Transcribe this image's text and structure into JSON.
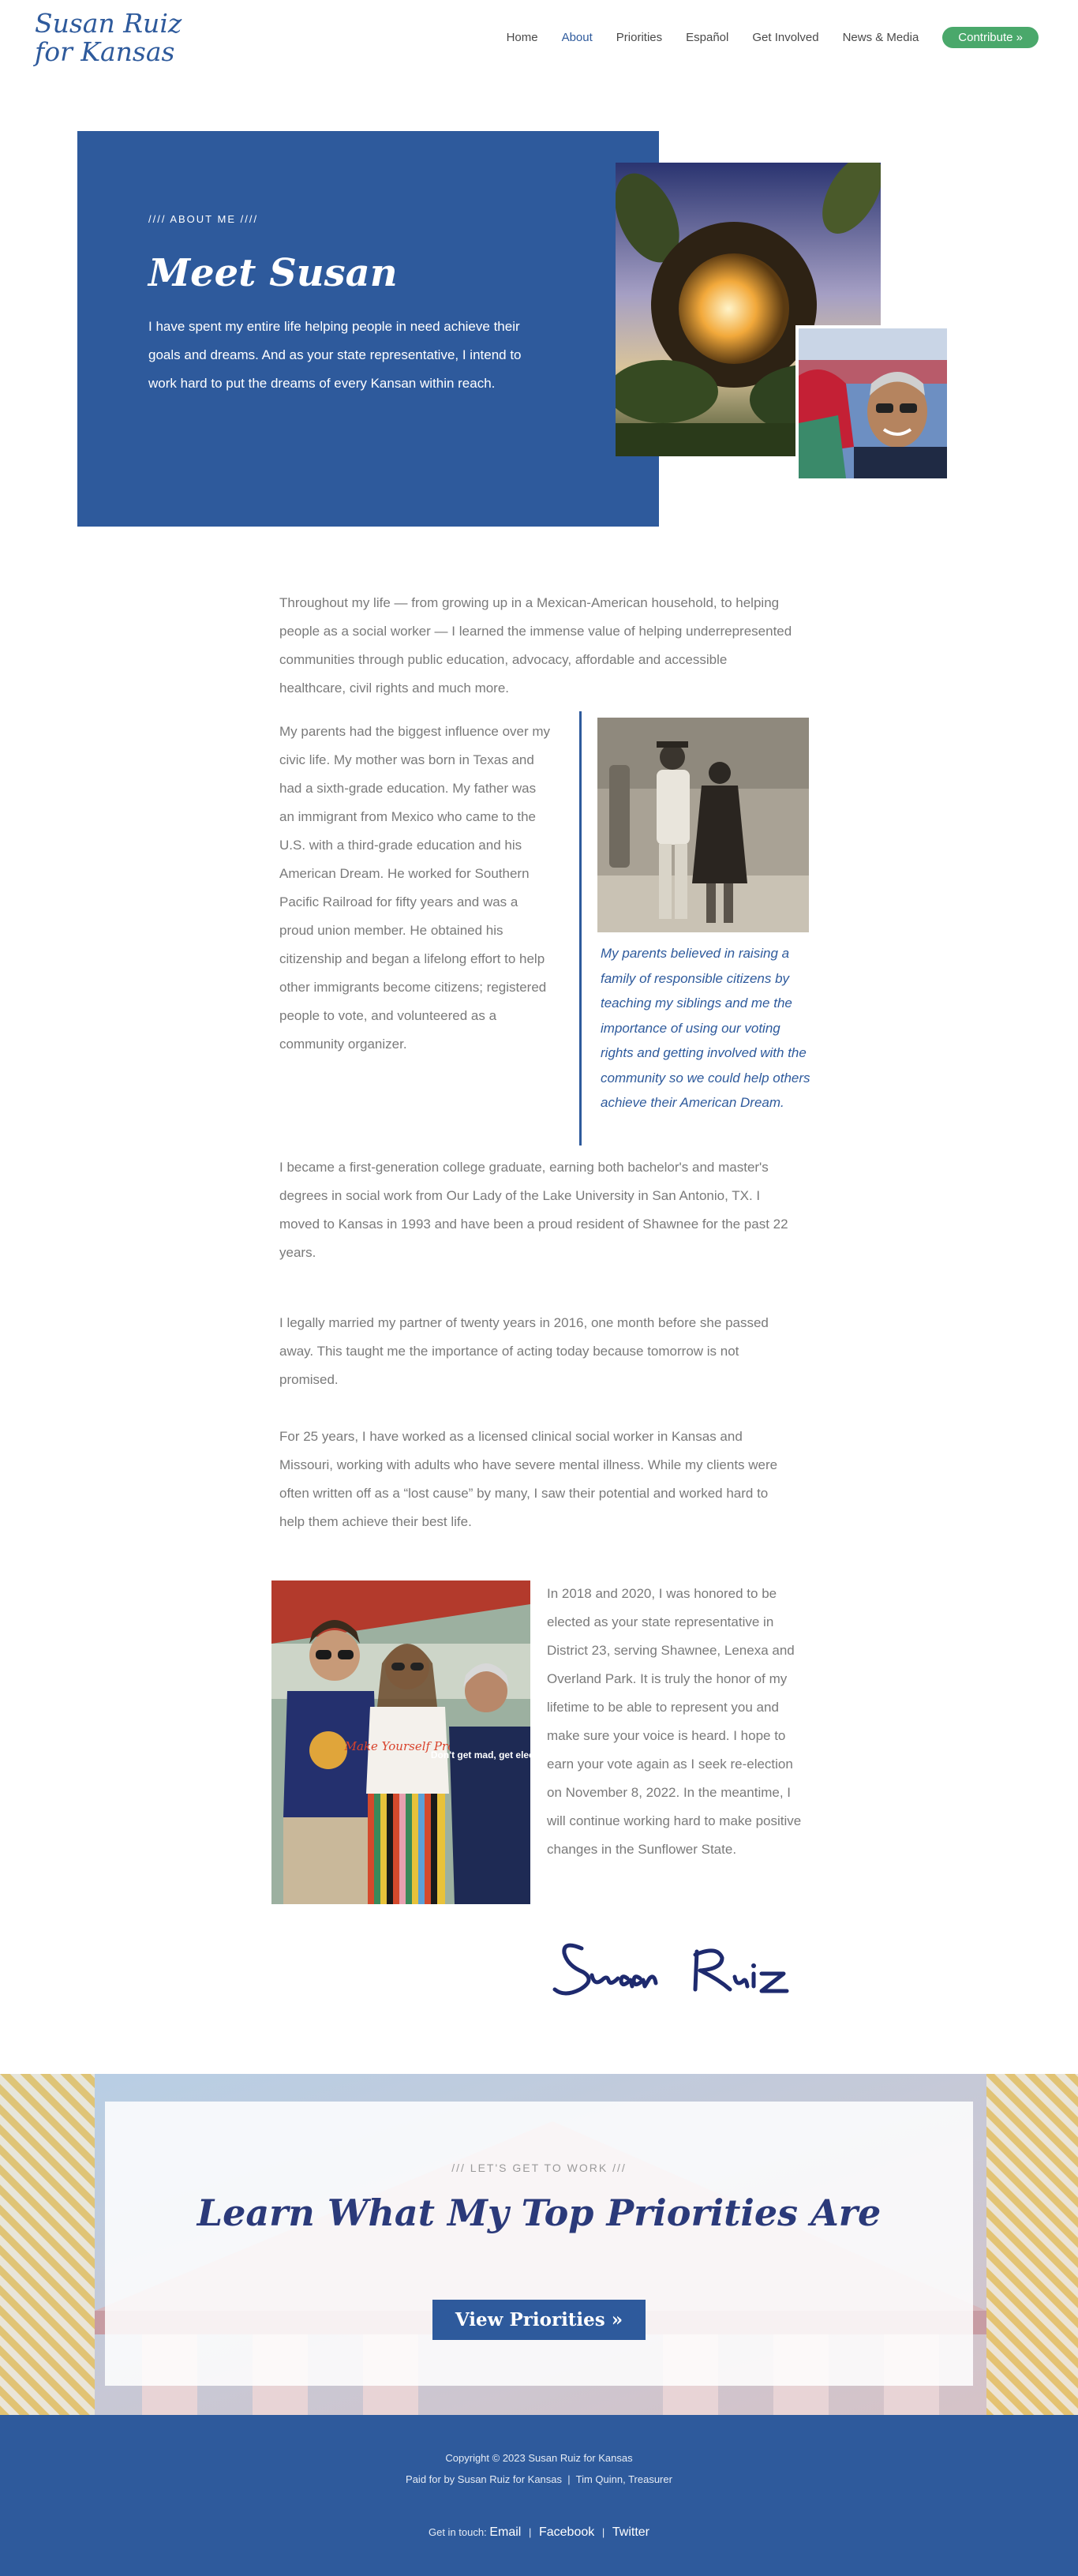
{
  "header": {
    "logo_line1": "Susan Ruiz",
    "logo_line2": "for Kansas",
    "nav": [
      {
        "label": "Home"
      },
      {
        "label": "About"
      },
      {
        "label": "Priorities"
      },
      {
        "label": "Español"
      },
      {
        "label": "Get Involved"
      },
      {
        "label": "News & Media"
      }
    ],
    "contribute_label": "Contribute  »"
  },
  "hero": {
    "eyebrow": "//// ABOUT ME ////",
    "title": "Meet Susan",
    "text": "I have spent my entire life helping people in need achieve their goals and dreams. And as your state representative, I intend to work hard to put the dreams of every Kansan within reach."
  },
  "body": {
    "p1": "Throughout my life — from growing up in a Mexican-American household, to helping people as a social worker — I learned the immense value of helping underrepresented communities through public education, advocacy, affordable and accessible healthcare, civil rights and much more.",
    "p2": "My parents had the biggest influence over my civic life. My mother was born in Texas and had a sixth-grade education. My father was an immigrant from Mexico who came to the U.S. with a third-grade education and his American Dream. He worked for Southern Pacific Railroad for fifty years and was a proud union member. He obtained his citizenship and began a lifelong effort to help other immigrants become citizens; registered people to vote, and volunteered as a community organizer.",
    "quote": "My parents believed in raising a family of responsible citizens by teaching my siblings and me the importance of using our voting rights and getting involved with the community so we could help others achieve their American Dream.",
    "p3": "I became a first-generation college graduate, earning both bachelor's and master's degrees in social work from Our Lady of the Lake University in San Antonio, TX. I moved to Kansas in 1993 and have been a proud resident of Shawnee for the past 22 years.",
    "p4": "I legally married my partner of twenty years in 2016, one month before she passed away. This taught me the importance of acting today because tomorrow is not promised.",
    "p5": "For 25 years, I have worked as a licensed clinical social worker in Kansas and Missouri, working with adults who have severe mental illness. While my clients were often written off as a “lost cause” by many, I saw their potential and worked hard to help them achieve their best life.",
    "p6": "In 2018 and 2020, I was honored to be elected as your state representative in District 23, serving Shawnee, Lenexa and Overland Park. It is truly the honor of my lifetime to be able to represent you and make sure your voice is heard. I hope to earn your vote again as I seek re-election on November 8, 2022. In the meantime, I will continue working hard to make positive changes in the Sunflower State.",
    "tshirt_center": "Make Yourself Proud",
    "tshirt_right": "Don't get mad, get elected."
  },
  "cta": {
    "eyebrow": "/// LET'S GET TO WORK ///",
    "title": "Learn What My Top Priorities Are",
    "button": "View Priorities »"
  },
  "footer": {
    "copyright": "Copyright © 2023 Susan Ruiz for Kansas",
    "paid_for": "Paid for by Susan Ruiz for Kansas  |  Tim Quinn, Treasurer",
    "get_in_touch": "Get in touch:",
    "links": [
      "Email",
      "Facebook",
      "Twitter"
    ]
  },
  "colors": {
    "brand_blue": "#2e5a9c",
    "cta_title": "#2b3a7a",
    "contribute_green": "#4aa86b"
  }
}
